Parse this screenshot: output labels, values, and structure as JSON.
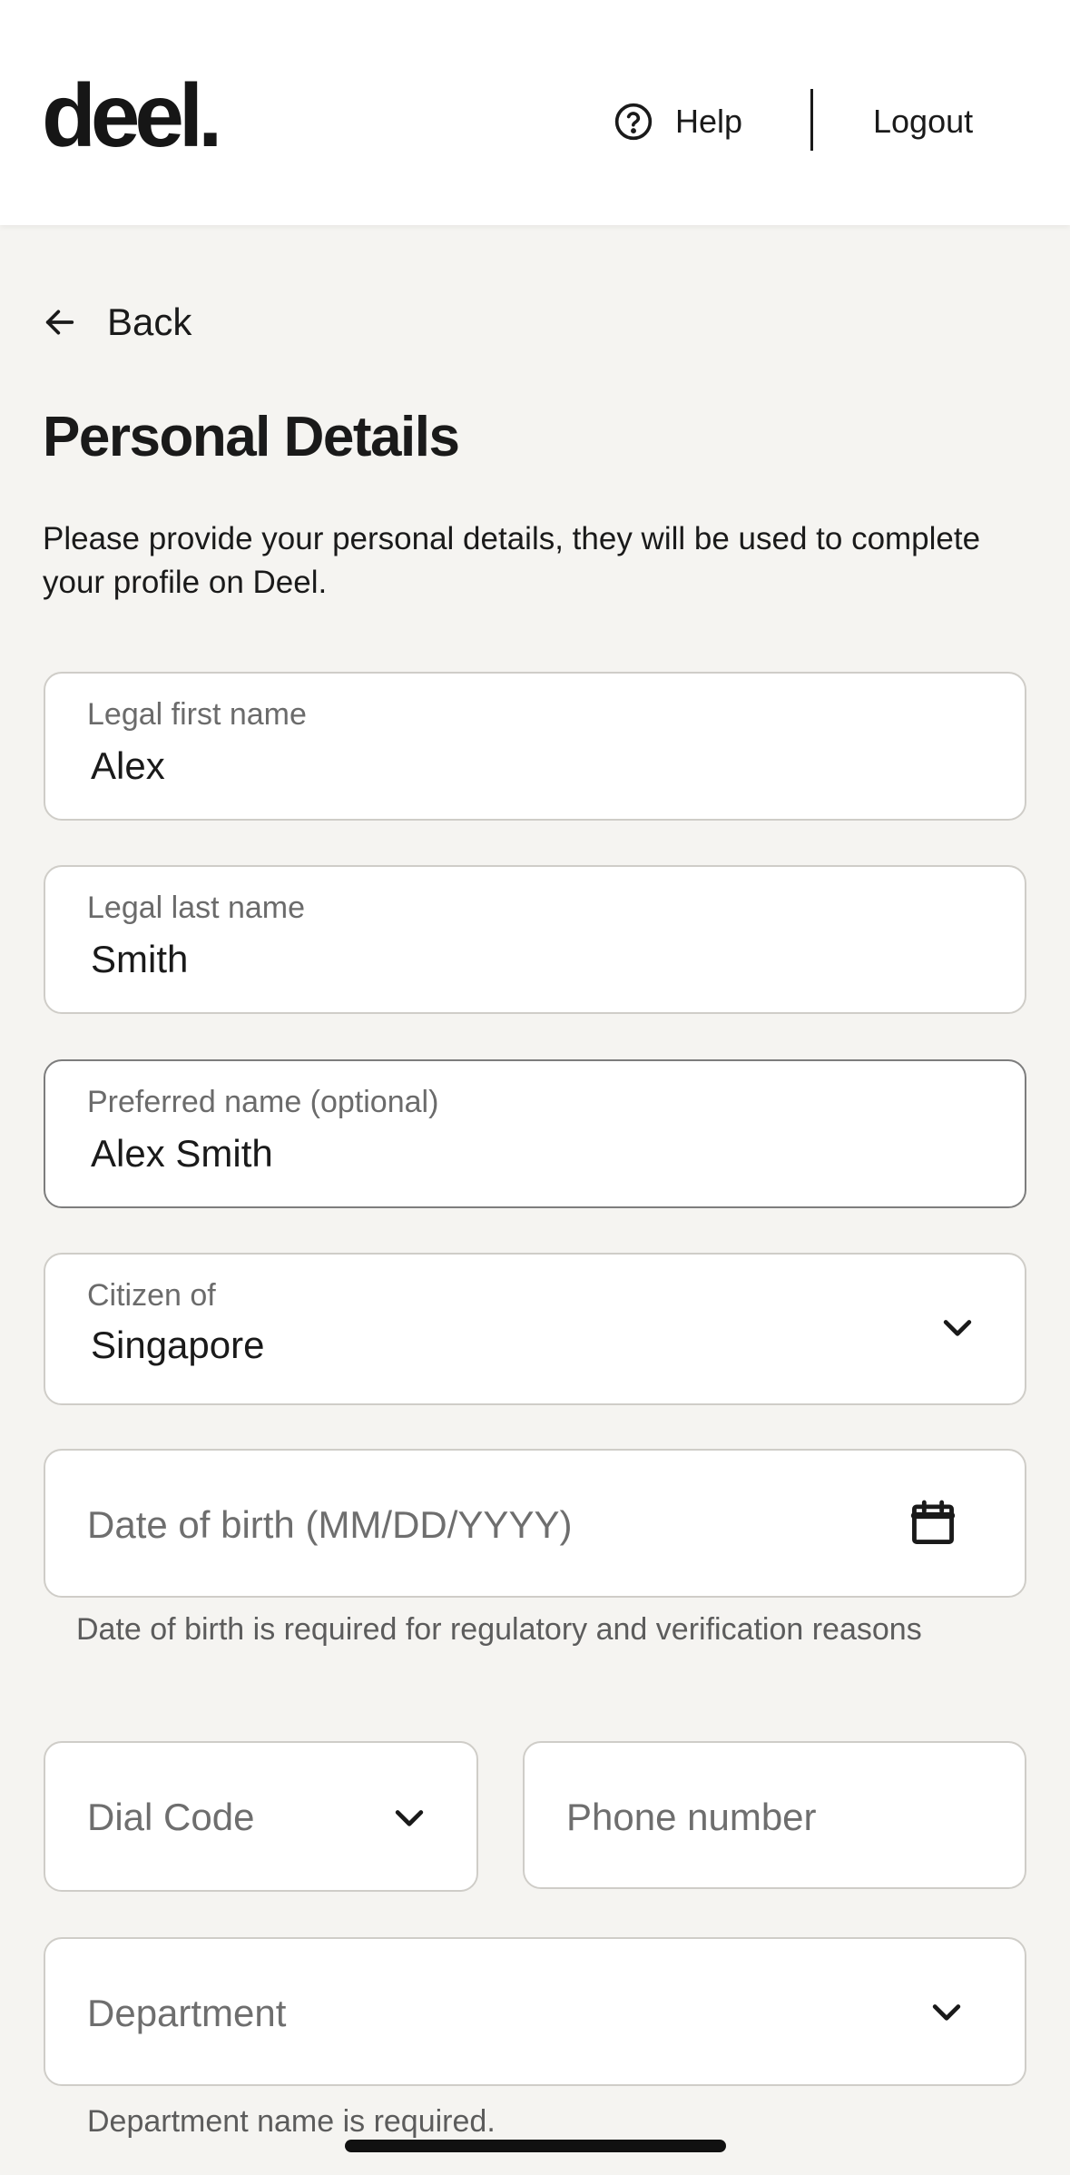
{
  "header": {
    "logo": "deel.",
    "help_label": "Help",
    "logout_label": "Logout"
  },
  "back_label": "Back",
  "page_title": "Personal Details",
  "intro": "Please provide your personal details, they will be used to complete your profile on Deel.",
  "form": {
    "first_name": {
      "label": "Legal first name",
      "value": "Alex"
    },
    "last_name": {
      "label": "Legal last name",
      "value": "Smith"
    },
    "preferred_name": {
      "label": "Preferred name (optional)",
      "value": "Alex Smith"
    },
    "citizen_of": {
      "label": "Citizen of",
      "value": "Singapore"
    },
    "date_of_birth": {
      "placeholder": "Date of birth (MM/DD/YYYY)",
      "hint": "Date of birth is required for regulatory and verification reasons"
    },
    "dial_code": {
      "placeholder": "Dial Code"
    },
    "phone_number": {
      "placeholder": "Phone number"
    },
    "department": {
      "placeholder": "Department",
      "error": "Department name is required."
    }
  },
  "icons": {
    "help": "question-circle-icon",
    "back": "arrow-left-icon",
    "dropdown": "chevron-down-icon",
    "calendar": "calendar-icon"
  }
}
